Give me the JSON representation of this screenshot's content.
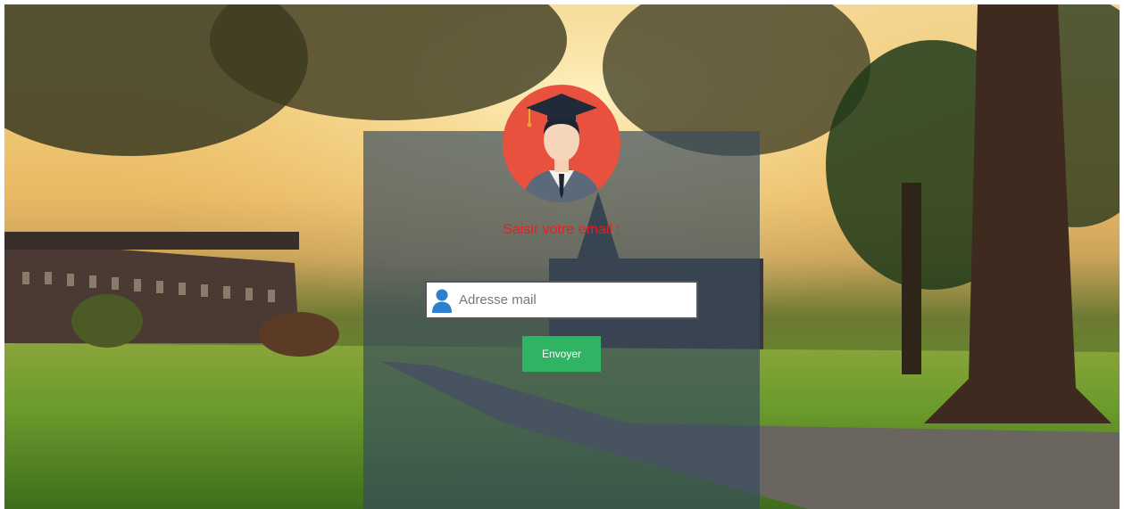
{
  "form": {
    "prompt": "Saisir votre email :",
    "email_placeholder": "Adresse mail",
    "email_value": "",
    "submit_label": "Envoyer"
  },
  "icons": {
    "avatar": "graduate-avatar-icon",
    "field": "user-icon"
  },
  "colors": {
    "prompt": "#ee1c1c",
    "button": "#2fb463",
    "avatar_bg": "#e9513f",
    "field_icon": "#2f7fd0"
  }
}
